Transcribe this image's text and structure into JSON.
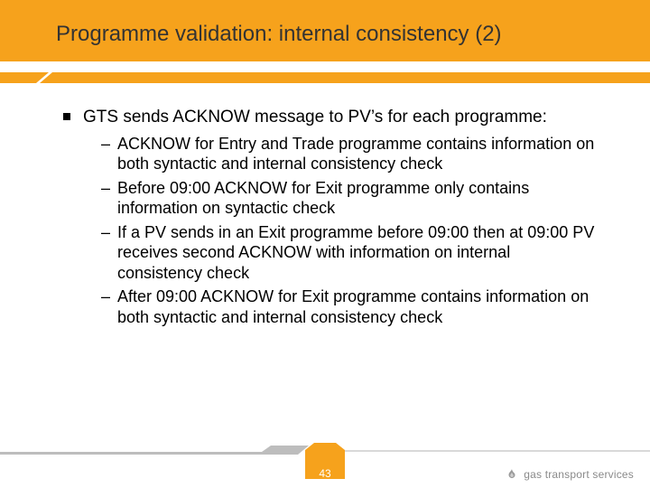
{
  "slide": {
    "title": "Programme validation: internal consistency (2)",
    "page_number": "43",
    "logo_text": "gas transport services"
  },
  "content": {
    "main_bullet": "GTS sends ACKNOW message to PV’s for each programme:",
    "sub_bullets": [
      "ACKNOW for Entry and Trade programme contains information on both syntactic and internal consistency check",
      "Before 09:00 ACKNOW for Exit programme only contains information on syntactic check",
      "If a PV sends in an Exit programme before 09:00 then at 09:00 PV receives second ACKNOW with information on internal consistency check",
      "After 09:00 ACKNOW for Exit programme contains information on both syntactic and internal consistency check"
    ]
  }
}
